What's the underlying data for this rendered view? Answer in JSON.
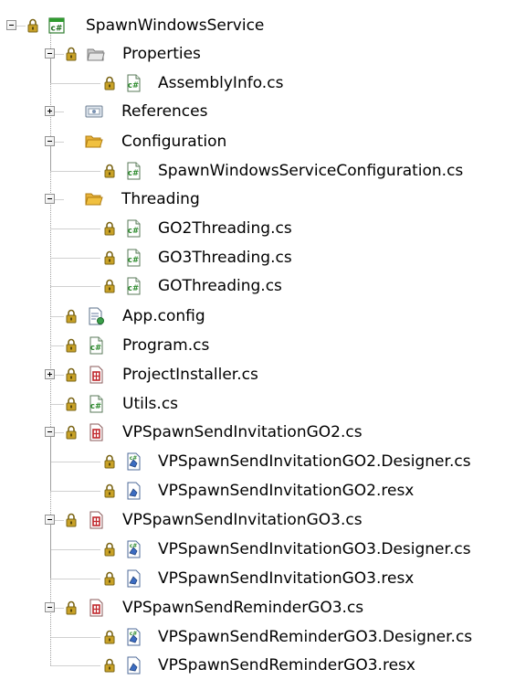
{
  "tree": {
    "items": [
      {
        "label": "SpawnWindowsService",
        "icon": "csharp-project-icon",
        "expander": "minus"
      },
      {
        "label": "Properties",
        "icon": "properties-folder-icon",
        "expander": "minus"
      },
      {
        "label": "AssemblyInfo.cs",
        "icon": "csharp-file-icon",
        "expander": null
      },
      {
        "label": "References",
        "icon": "references-icon",
        "expander": "plus"
      },
      {
        "label": "Configuration",
        "icon": "folder-open-icon",
        "expander": "minus"
      },
      {
        "label": "SpawnWindowsServiceConfiguration.cs",
        "icon": "csharp-file-icon",
        "expander": null
      },
      {
        "label": "Threading",
        "icon": "folder-open-icon",
        "expander": "minus"
      },
      {
        "label": "GO2Threading.cs",
        "icon": "csharp-file-icon",
        "expander": null
      },
      {
        "label": "GO3Threading.cs",
        "icon": "csharp-file-icon",
        "expander": null
      },
      {
        "label": "GOThreading.cs",
        "icon": "csharp-file-icon",
        "expander": null
      },
      {
        "label": "App.config",
        "icon": "config-file-icon",
        "expander": null
      },
      {
        "label": "Program.cs",
        "icon": "csharp-file-icon",
        "expander": null
      },
      {
        "label": "ProjectInstaller.cs",
        "icon": "component-file-icon",
        "expander": "plus"
      },
      {
        "label": "Utils.cs",
        "icon": "csharp-file-icon",
        "expander": null
      },
      {
        "label": "VPSpawnSendInvitationGO2.cs",
        "icon": "component-file-icon",
        "expander": "minus"
      },
      {
        "label": "VPSpawnSendInvitationGO2.Designer.cs",
        "icon": "designer-file-icon",
        "expander": null
      },
      {
        "label": "VPSpawnSendInvitationGO2.resx",
        "icon": "resx-file-icon",
        "expander": null
      },
      {
        "label": "VPSpawnSendInvitationGO3.cs",
        "icon": "component-file-icon",
        "expander": "minus"
      },
      {
        "label": "VPSpawnSendInvitationGO3.Designer.cs",
        "icon": "designer-file-icon",
        "expander": null
      },
      {
        "label": "VPSpawnSendInvitationGO3.resx",
        "icon": "resx-file-icon",
        "expander": null
      },
      {
        "label": "VPSpawnSendReminderGO3.cs",
        "icon": "component-file-icon",
        "expander": "minus"
      },
      {
        "label": "VPSpawnSendReminderGO3.Designer.cs",
        "icon": "designer-file-icon",
        "expander": null
      },
      {
        "label": "VPSpawnSendReminderGO3.resx",
        "icon": "resx-file-icon",
        "expander": null
      }
    ]
  },
  "colors": {
    "lock": "#c9a227",
    "csharp_green": "#2e8b2e",
    "folder": "#f0c040",
    "component_red": "#c0282d",
    "resx_blue": "#3b6cc2",
    "tree_line": "#a0a0a0"
  }
}
